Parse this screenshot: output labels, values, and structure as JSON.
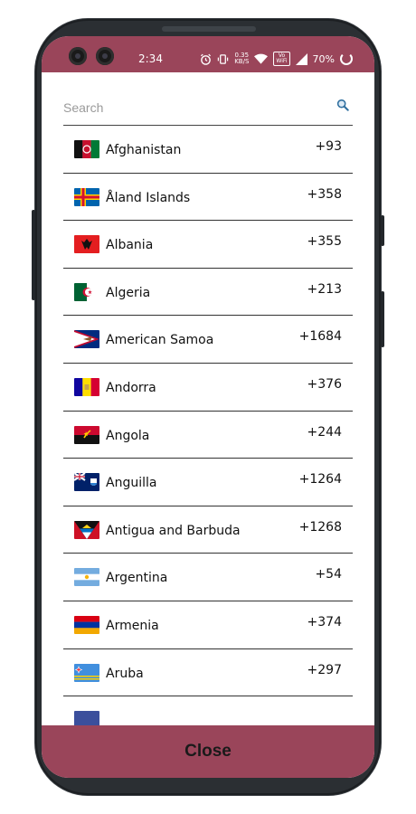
{
  "status_bar": {
    "time": "2:34",
    "net_speed_value": "0.35",
    "net_speed_unit": "KB/S",
    "volte_line1": "Vo",
    "volte_line2": "WiFi",
    "battery": "70%",
    "icons": [
      "alarm-icon",
      "vibrate-icon",
      "wifi-icon",
      "signal-icon",
      "battery-icon"
    ]
  },
  "search": {
    "placeholder": "Search",
    "value": ""
  },
  "countries": [
    {
      "name": "Afghanistan",
      "code": "+93"
    },
    {
      "name": "Åland Islands",
      "code": "+358"
    },
    {
      "name": "Albania",
      "code": "+355"
    },
    {
      "name": "Algeria",
      "code": "+213"
    },
    {
      "name": "American Samoa",
      "code": "+1684"
    },
    {
      "name": "Andorra",
      "code": "+376"
    },
    {
      "name": "Angola",
      "code": "+244"
    },
    {
      "name": "Anguilla",
      "code": "+1264"
    },
    {
      "name": "Antigua and Barbuda",
      "code": "+1268"
    },
    {
      "name": "Argentina",
      "code": "+54"
    },
    {
      "name": "Armenia",
      "code": "+374"
    },
    {
      "name": "Aruba",
      "code": "+297"
    }
  ],
  "close_label": "Close",
  "colors": {
    "accent": "#9a455a"
  }
}
